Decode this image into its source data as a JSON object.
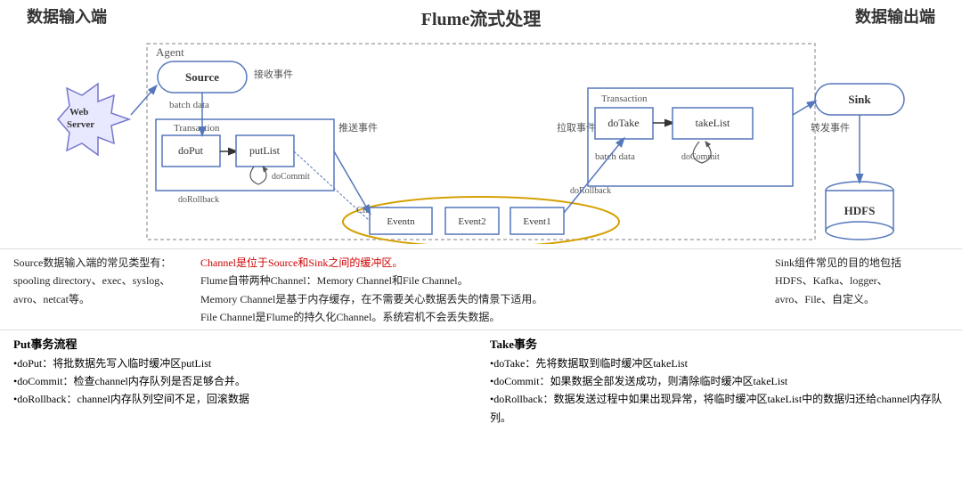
{
  "titles": {
    "left": "数据输入端",
    "center": "Flume流式处理",
    "right": "数据输出端"
  },
  "diagram": {
    "agent_label": "Agent",
    "channel_label": "Channel",
    "transaction1_label": "Transaction",
    "transaction2_label": "Transaction",
    "source_label": "Source",
    "sink_label": "Sink",
    "webserver_label": "Web\nServer",
    "hdfs_label": "HDFS",
    "batch_data1": "batch data",
    "batch_data2": "batch data",
    "doPut": "doPut",
    "putList": "putList",
    "doCommit1": "doCommit",
    "doRollback1": "doRollback",
    "doTake": "doTake",
    "takeList": "takeList",
    "doCommit2": "doCommit",
    "doRollback2": "doRollback",
    "push_event": "推送事件",
    "pull_event": "拉取事件",
    "receive_event": "接收事件",
    "forward_event": "转发事件",
    "eventn": "Eventn",
    "event2": "Event2",
    "event1": "Event1"
  },
  "bottom": {
    "left_title": "Source数据输入端的常见类型有：",
    "left_items": [
      "spooling directory、exec、syslog、",
      "avro、netcat等。"
    ],
    "middle_line1": "Channel是位于Source和Sink之间的缓冲区。",
    "middle_line2": "Flume自带两种Channel：Memory Channel和File Channel。",
    "middle_line3": "Memory Channel是基于内存缓存，在不需要关心数据丢失的情景下适用。",
    "middle_line4": "File Channel是Flume的持久化Channel。系统宕机不会丢失数据。",
    "right_title": "Sink组件常见的目的地包括",
    "right_items": [
      "HDFS、Kafka、logger、",
      "avro、File、自定义。"
    ]
  },
  "process": {
    "put_title": "Put事务流程",
    "put_items": [
      "•doPut：将批数据先写入临时缓冲区putList",
      "•doCommit：检查channel内存队列是否足够合并。",
      "•doRollback：channel内存队列空间不足，回滚数据"
    ],
    "take_title": "Take事务",
    "take_items": [
      "•doTake：先将数据取到临时缓冲区takeList",
      "•doCommit：如果数据全部发送成功，则清除临时缓冲区takeList",
      "•doRollback：数据发送过程中如果出现异常，将临时缓冲区takeList中的数据归还给channel内存队列。"
    ]
  }
}
